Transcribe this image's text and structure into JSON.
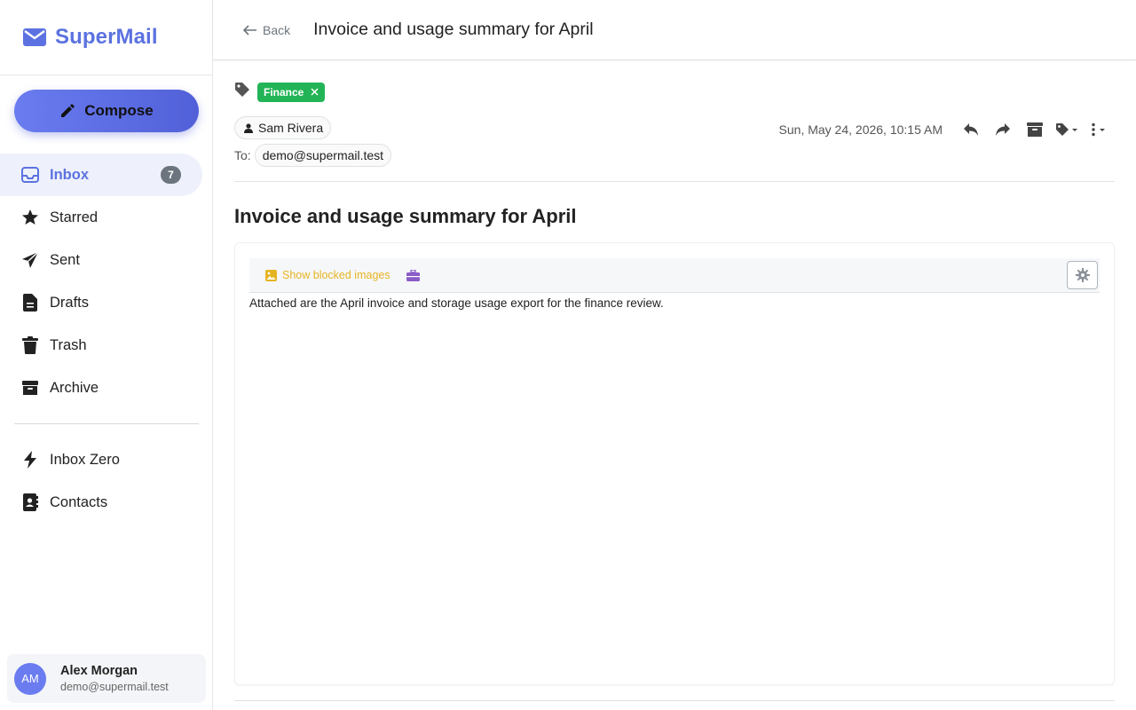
{
  "app": {
    "name": "SuperMail",
    "brand_color": "#5b72e0"
  },
  "compose": {
    "label": "Compose"
  },
  "nav": {
    "items": [
      {
        "label": "Inbox",
        "icon": "inbox-icon",
        "badge": "7",
        "active": true
      },
      {
        "label": "Starred",
        "icon": "star-icon"
      },
      {
        "label": "Sent",
        "icon": "send-icon"
      },
      {
        "label": "Drafts",
        "icon": "file-icon"
      },
      {
        "label": "Trash",
        "icon": "trash-icon"
      },
      {
        "label": "Archive",
        "icon": "archive-icon"
      }
    ],
    "secondary": [
      {
        "label": "Inbox Zero",
        "icon": "bolt-icon"
      },
      {
        "label": "Contacts",
        "icon": "contacts-icon"
      }
    ]
  },
  "user": {
    "initials": "AM",
    "name": "Alex Morgan",
    "email": "demo@supermail.test"
  },
  "header": {
    "back_label": "Back",
    "title": "Invoice and usage summary for April"
  },
  "message": {
    "tag": {
      "label": "Finance",
      "color": "#22b456"
    },
    "from": "Sam Rivera",
    "to_label": "To:",
    "to": "demo@supermail.test",
    "date": "Sun, May 24, 2026, 10:15 AM",
    "subject": "Invoice and usage summary for April",
    "show_images_label": "Show blocked images",
    "body": "Attached are the April invoice and storage usage export for the finance review."
  }
}
